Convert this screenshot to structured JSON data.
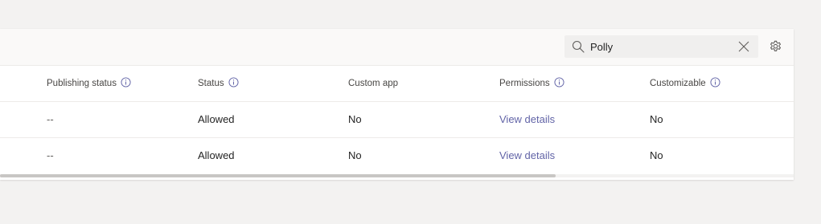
{
  "search": {
    "value": "Polly",
    "icon": "search-icon"
  },
  "toolbar": {
    "clear_icon": "close-icon",
    "settings_icon": "gear-icon"
  },
  "table": {
    "columns": [
      {
        "label": "Publishing status",
        "info": true
      },
      {
        "label": "Status",
        "info": true
      },
      {
        "label": "Custom app",
        "info": false
      },
      {
        "label": "Permissions",
        "info": true
      },
      {
        "label": "Customizable",
        "info": true
      }
    ],
    "rows": [
      {
        "publishing_status": "--",
        "status": "Allowed",
        "custom_app": "No",
        "permissions": "View details",
        "customizable": "No"
      },
      {
        "publishing_status": "--",
        "status": "Allowed",
        "custom_app": "No",
        "permissions": "View details",
        "customizable": "No"
      }
    ]
  },
  "colors": {
    "link": "#6264a7",
    "background": "#f3f2f1",
    "panel": "#ffffff"
  },
  "scroll": {
    "horizontal_fraction_visible": 0.7
  }
}
